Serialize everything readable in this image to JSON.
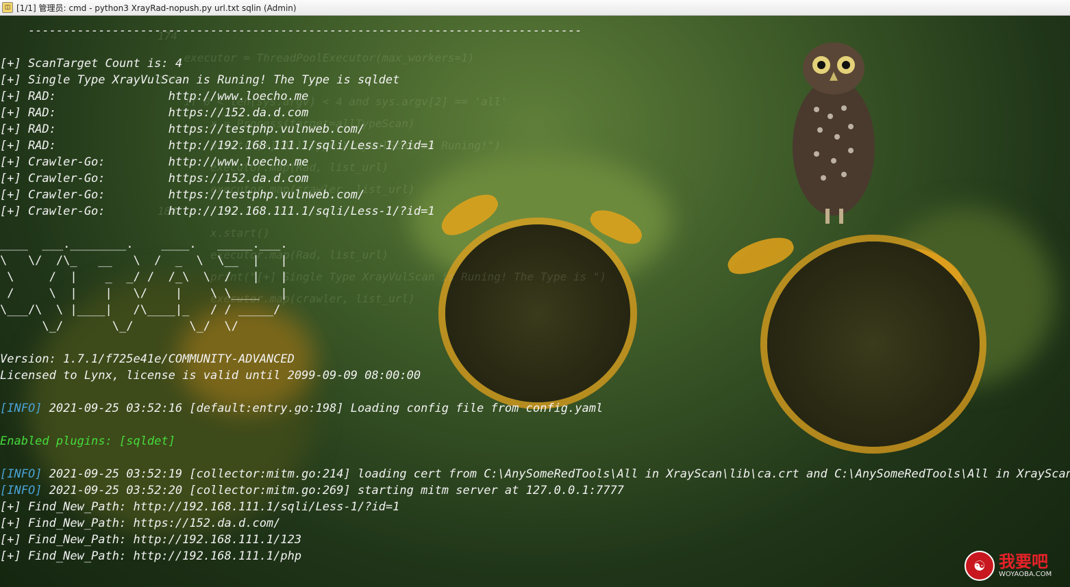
{
  "window": {
    "title": "[1/1] 管理员: cmd - python3  XrayRad-nopush.py url.txt sqlin (Admin)",
    "app_icon": "console-icon"
  },
  "watermark": {
    "text": "我要吧",
    "url": "WOYAOBA.COM"
  },
  "terminal": {
    "lines": [
      {
        "text": "    -------------------------------------------------------------------------------",
        "style": "normal"
      },
      {
        "text": "",
        "style": "normal"
      },
      {
        "text": "[+] ScanTarget Count is: 4",
        "style": "normal"
      },
      {
        "text": "[+] Single Type XrayVulScan is Runing! The Type is sqldet",
        "style": "normal"
      },
      {
        "text": "[+] RAD:                http://www.loecho.me",
        "style": "normal"
      },
      {
        "text": "[+] RAD:                https://152.da.d.com",
        "style": "normal"
      },
      {
        "text": "[+] RAD:                https://testphp.vulnweb.com/",
        "style": "normal"
      },
      {
        "text": "[+] RAD:                http://192.168.111.1/sqli/Less-1/?id=1",
        "style": "normal"
      },
      {
        "text": "[+] Crawler-Go:         http://www.loecho.me",
        "style": "normal"
      },
      {
        "text": "[+] Crawler-Go:         https://152.da.d.com",
        "style": "normal"
      },
      {
        "text": "[+] Crawler-Go:         https://testphp.vulnweb.com/",
        "style": "normal"
      },
      {
        "text": "[+] Crawler-Go:         http://192.168.111.1/sqli/Less-1/?id=1",
        "style": "normal"
      },
      {
        "text": "",
        "style": "normal"
      },
      {
        "text": "____  ___.________.    ____.   _____.___.",
        "style": "ascii"
      },
      {
        "text": "\\   \\/  /\\_   __   \\  /  _  \\  \\__  |   |",
        "style": "ascii"
      },
      {
        "text": " \\     /  |    _  _/ /  /_\\  \\  /   |   |",
        "style": "ascii"
      },
      {
        "text": " /     \\  |    |   \\/    |    \\ \\____   |",
        "style": "ascii"
      },
      {
        "text": "\\___/\\  \\ |____|   /\\____|_   / / _____/",
        "style": "ascii"
      },
      {
        "text": "      \\_/       \\_/        \\_/  \\/",
        "style": "ascii"
      },
      {
        "text": "",
        "style": "normal"
      },
      {
        "text": "Version: 1.7.1/f725e41e/COMMUNITY-ADVANCED",
        "style": "normal"
      },
      {
        "text": "Licensed to Lynx, license is valid until 2099-09-09 08:00:00",
        "style": "normal"
      },
      {
        "text": "",
        "style": "normal"
      },
      {
        "tag": "[INFO]",
        "text": " 2021-09-25 03:52:16 [default:entry.go:198] Loading config file from config.yaml",
        "style": "info"
      },
      {
        "text": "",
        "style": "normal"
      },
      {
        "text": "Enabled plugins: [sqldet]",
        "style": "green"
      },
      {
        "text": "",
        "style": "normal"
      },
      {
        "tag": "[INFO]",
        "text": " 2021-09-25 03:52:19 [collector:mitm.go:214] loading cert from C:\\AnySomeRedTools\\All in XrayScan\\lib\\ca.crt and C:\\AnySomeRedTools\\All in XrayScan\\lib",
        "style": "info"
      },
      {
        "tag": "[INFO]",
        "text": " 2021-09-25 03:52:20 [collector:mitm.go:269] starting mitm server at 127.0.0.1:7777",
        "style": "info"
      },
      {
        "text": "[+] Find_New_Path: http://192.168.111.1/sqli/Less-1/?id=1",
        "style": "normal"
      },
      {
        "text": "[+] Find_New_Path: https://152.da.d.com/",
        "style": "normal"
      },
      {
        "text": "[+] Find_New_Path: http://192.168.111.1/123",
        "style": "normal"
      },
      {
        "text": "[+] Find_New_Path: http://192.168.111.1/php",
        "style": "normal"
      }
    ]
  }
}
